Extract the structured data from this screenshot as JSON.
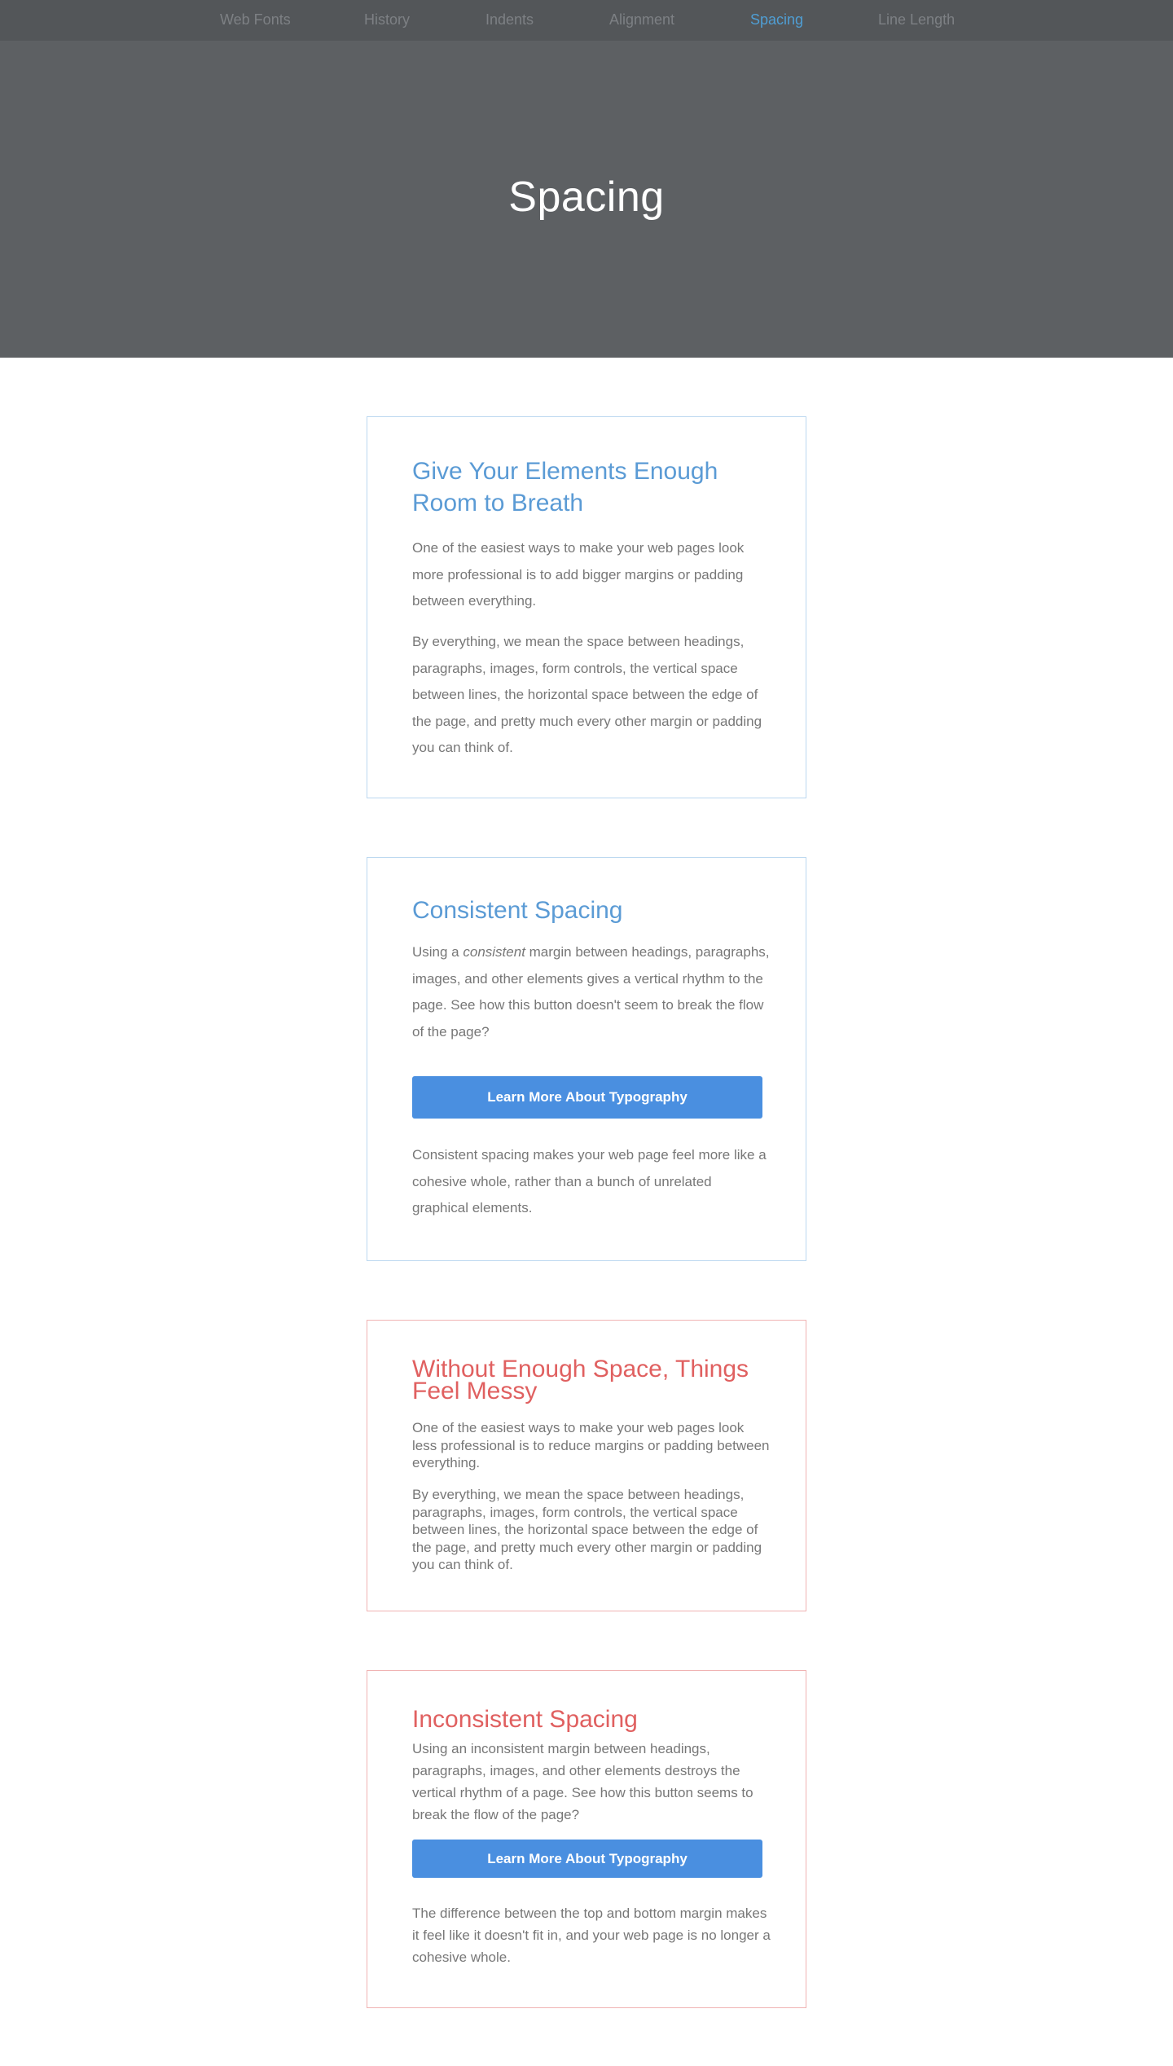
{
  "nav": {
    "items": [
      {
        "label": "Web Fonts",
        "active": false
      },
      {
        "label": "History",
        "active": false
      },
      {
        "label": "Indents",
        "active": false
      },
      {
        "label": "Alignment",
        "active": false
      },
      {
        "label": "Spacing",
        "active": true
      },
      {
        "label": "Line Length",
        "active": false
      }
    ]
  },
  "hero": {
    "title": "Spacing"
  },
  "cards": [
    {
      "title": "Give Your Elements Enough Room to Breath",
      "paragraphs": [
        "One of the easiest ways to make your web pages look more professional is to add bigger margins or padding between everything.",
        "By everything, we mean the space between headings, paragraphs, images, form controls, the vertical space between lines, the horizontal space between the edge of the page, and pretty much every other margin or padding you can think of."
      ]
    },
    {
      "title": "Consistent Spacing",
      "p1_before": "Using a ",
      "p1_emphasis": "consistent",
      "p1_after": " margin between headings, paragraphs, images, and other elements gives a vertical rhythm to the page. See how this button doesn't seem to break the flow of the page?",
      "button_label": "Learn More About Typography",
      "p2": "Consistent spacing makes your web page feel more like a cohesive whole, rather than a bunch of unrelated graphical elements."
    },
    {
      "title": "Without Enough Space, Things Feel Messy",
      "paragraphs": [
        "One of the easiest ways to make your web pages look less professional is to reduce margins or padding between everything.",
        "By everything, we mean the space between headings, paragraphs, images, form controls, the vertical space between lines, the horizontal space between the edge of the page, and pretty much every other margin or padding you can think of."
      ]
    },
    {
      "title": "Inconsistent Spacing",
      "p1": "Using an inconsistent margin between headings, paragraphs, images, and other elements destroys the vertical rhythm of a page. See how this button seems to break the flow of the page?",
      "button_label": "Learn More About Typography",
      "p2": "The difference between the top and bottom margin makes it feel like it doesn't fit in, and your web page is no longer a cohesive whole."
    }
  ],
  "colors": {
    "accent_blue": "#5b9bd5",
    "accent_red": "#e06060",
    "button": "#4a8fe0",
    "nav_active": "#4f9ed4"
  }
}
